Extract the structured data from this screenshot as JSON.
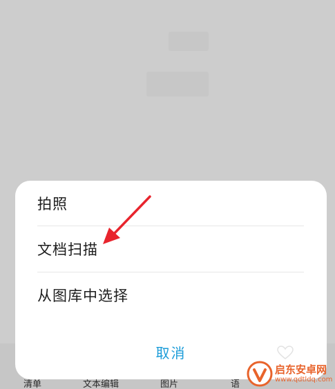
{
  "action_sheet": {
    "items": [
      {
        "label": "拍照"
      },
      {
        "label": "文档扫描"
      },
      {
        "label": "从图库中选择"
      }
    ],
    "cancel_label": "取消"
  },
  "bottom_toolbar": {
    "items": [
      {
        "label": "清单"
      },
      {
        "label": "文本编辑"
      },
      {
        "label": "图片"
      },
      {
        "label": "语"
      }
    ]
  },
  "annotation": {
    "type": "arrow",
    "color": "#e8242d",
    "points_to": "文档扫描"
  },
  "watermark": {
    "title": "启东安卓网",
    "url": "www.qdtldq.com"
  },
  "colors": {
    "overlay": "#cdcdcd",
    "sheet_bg": "#ffffff",
    "accent": "#1a9bd8",
    "annotation": "#e8242d",
    "watermark": "#e8632b"
  }
}
